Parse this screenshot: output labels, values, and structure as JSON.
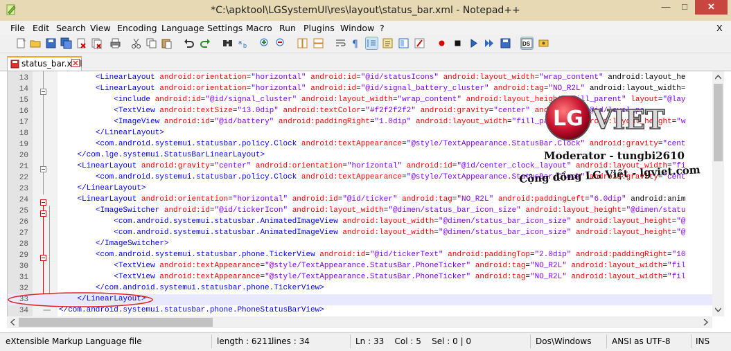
{
  "window": {
    "title": "*C:\\apktool\\LGSystemUI\\res\\layout\\status_bar.xml - Notepad++",
    "minimize": "—",
    "maximize": "□",
    "close": "✕"
  },
  "menu": {
    "items": [
      "File",
      "Edit",
      "Search",
      "View",
      "Encoding",
      "Language",
      "Settings",
      "Macro",
      "Run",
      "Plugins",
      "Window",
      "?"
    ],
    "close": "X"
  },
  "tab": {
    "label": "status_bar.xml"
  },
  "editor": {
    "lines": [
      {
        "n": "13",
        "code": "        <LinearLayout android:orientation=\"horizontal\" android:id=\"@id/statusIcons\" android:layout_width=\"wrap_content\" android:layout_he"
      },
      {
        "n": "14",
        "code": "        <LinearLayout android:orientation=\"horizontal\" android:id=\"@id/signal_battery_cluster\" android:tag=\"NO_R2L\" android:layout_width="
      },
      {
        "n": "15",
        "code": "            <include android:id=\"@id/signal_cluster\" android:layout_width=\"wrap_content\" android:layout_height=\"fill_parent\" layout=\"@lay"
      },
      {
        "n": "16",
        "code": "            <TextView android:textSize=\"13.0dip\" android:textColor=\"#f2f2f2f2\" android:gravity=\"center\" android:id=\"@id/level_pe"
      },
      {
        "n": "17",
        "code": "            <ImageView android:id=\"@id/battery\" android:paddingRight=\"1.0dip\" android:layout_width=\"fill_parent\" android:layout_height=\"w"
      },
      {
        "n": "18",
        "code": "        </LinearLayout>"
      },
      {
        "n": "19",
        "code": "        <com.android.systemui.statusbar.policy.Clock android:textAppearance=\"@style/TextAppearance.StatusBar.Clock\" android:gravity=\"cent"
      },
      {
        "n": "20",
        "code": "    </com.lge.systemui.StatusBarLinearLayout>"
      },
      {
        "n": "21",
        "code": "    <LinearLayout android:gravity=\"center\" android:orientation=\"horizontal\" android:id=\"@id/center_clock_layout\" android:layout_width=\"fi"
      },
      {
        "n": "22",
        "code": "        <com.android.systemui.statusbar.policy.Clock android:textAppearance=\"@style/TextAppearance.StatusBar.Clock\" android:gravity=\"cent"
      },
      {
        "n": "23",
        "code": "    </LinearLayout>"
      },
      {
        "n": "24",
        "code": "    <LinearLayout android:orientation=\"horizontal\" android:id=\"@id/ticker\" android:tag=\"NO_R2L\" android:paddingLeft=\"6.0dip\" android:anim"
      },
      {
        "n": "25",
        "code": "        <ImageSwitcher android:id=\"@id/tickerIcon\" android:layout_width=\"@dimen/status_bar_icon_size\" android:layout_height=\"@dimen/statu"
      },
      {
        "n": "26",
        "code": "            <com.android.systemui.statusbar.AnimatedImageView android:layout_width=\"@dimen/status_bar_icon_size\" android:layout_height=\"@"
      },
      {
        "n": "27",
        "code": "            <com.android.systemui.statusbar.AnimatedImageView android:layout_width=\"@dimen/status_bar_icon_size\" android:layout_height=\"@"
      },
      {
        "n": "28",
        "code": "        </ImageSwitcher>"
      },
      {
        "n": "29",
        "code": "        <com.android.systemui.statusbar.phone.TickerView android:id=\"@id/tickerText\" android:paddingTop=\"2.0dip\" android:paddingRight=\"10"
      },
      {
        "n": "30",
        "code": "            <TextView android:textAppearance=\"@style/TextAppearance.StatusBar.PhoneTicker\" android:tag=\"NO_R2L\" android:layout_width=\"fil"
      },
      {
        "n": "31",
        "code": "            <TextView android:textAppearance=\"@style/TextAppearance.StatusBar.PhoneTicker\" android:tag=\"NO_R2L\" android:layout_width=\"fil"
      },
      {
        "n": "32",
        "code": "        </com.android.systemui.statusbar.phone.TickerView>"
      },
      {
        "n": "33",
        "code": "    </LinearLayout>"
      },
      {
        "n": "34",
        "code": "</com.android.systemui.statusbar.phone.PhoneStatusBarView>"
      }
    ]
  },
  "status": {
    "filetype": "eXtensible Markup Language file",
    "length": "length : 6211",
    "lines": "lines : 34",
    "position": "Ln : 33    Col : 5    Sel : 0 | 0",
    "eol": "Dos\\Windows",
    "encoding": "ANSI as UTF-8",
    "mode": "INS"
  },
  "watermark": {
    "logo_text": "LG",
    "brand": "VIET",
    "moderator": "Moderator - tungbi2610",
    "community": "Cộng đồng LG Việt - lgviet.com"
  },
  "colors": {
    "tag": "#0000ff",
    "attr": "#ff0000",
    "value": "#8000ff",
    "titlebar": "#e7d9b3",
    "close_button": "#c7463f",
    "current_line": "#e8e8ff"
  }
}
